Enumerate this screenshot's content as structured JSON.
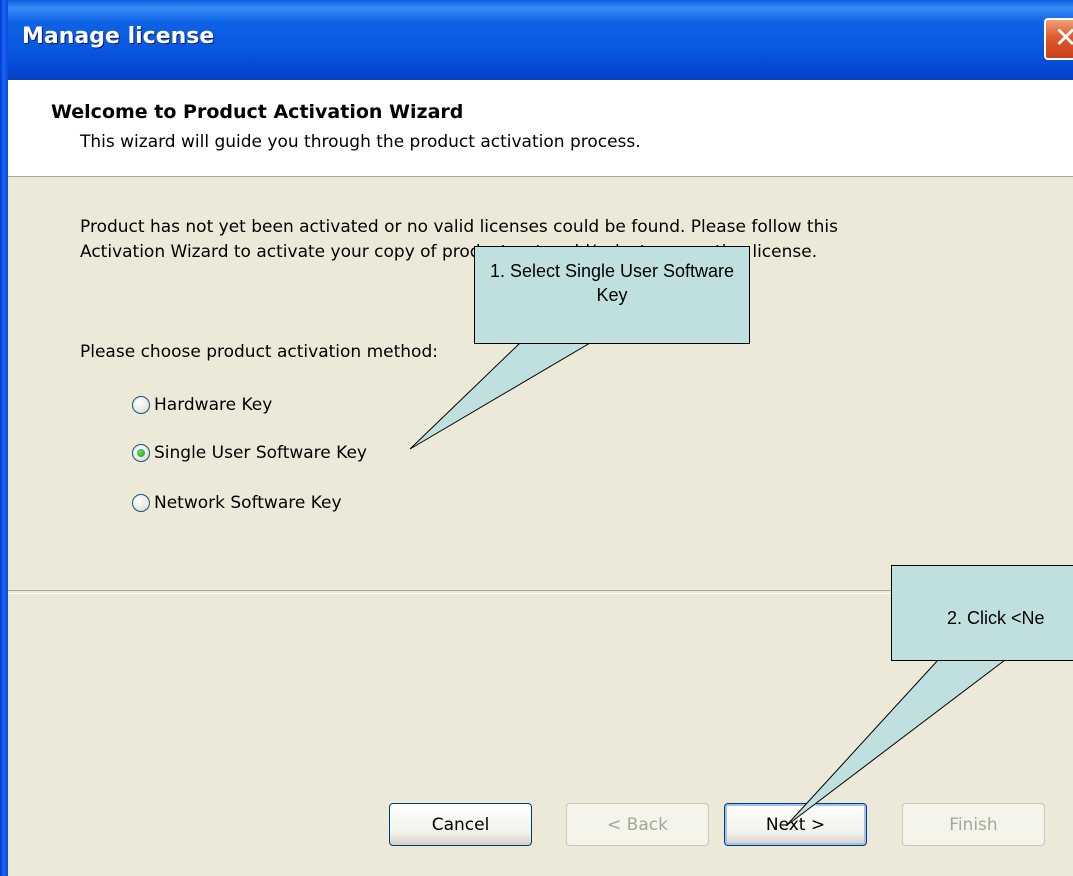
{
  "window": {
    "title": "Manage license",
    "close_glyph": "✕"
  },
  "header": {
    "heading": "Welcome to Product Activation Wizard",
    "subheading": "This wizard will guide you through the product activation process."
  },
  "body": {
    "intro_line1": "Product has not yet been activated or no valid licenses could be found. Please follow this",
    "intro_line2": "Activation Wizard to activate your copy of product or to add/select your active license.",
    "choose_label": "Please choose product activation method:",
    "options": [
      {
        "label": "Hardware Key",
        "checked": false
      },
      {
        "label": "Single User Software Key",
        "checked": true
      },
      {
        "label": "Network Software Key",
        "checked": false
      }
    ]
  },
  "buttons": {
    "cancel": "Cancel",
    "back": "< Back",
    "next": "Next >",
    "finish": "Finish"
  },
  "callouts": {
    "first": "1. Select Single User Software Key",
    "second": "2. Click <Ne"
  },
  "colors": {
    "titlebar": "#0a58e0",
    "dialog_bg": "#ece9d8",
    "callout_bg": "#c0e0e0"
  }
}
